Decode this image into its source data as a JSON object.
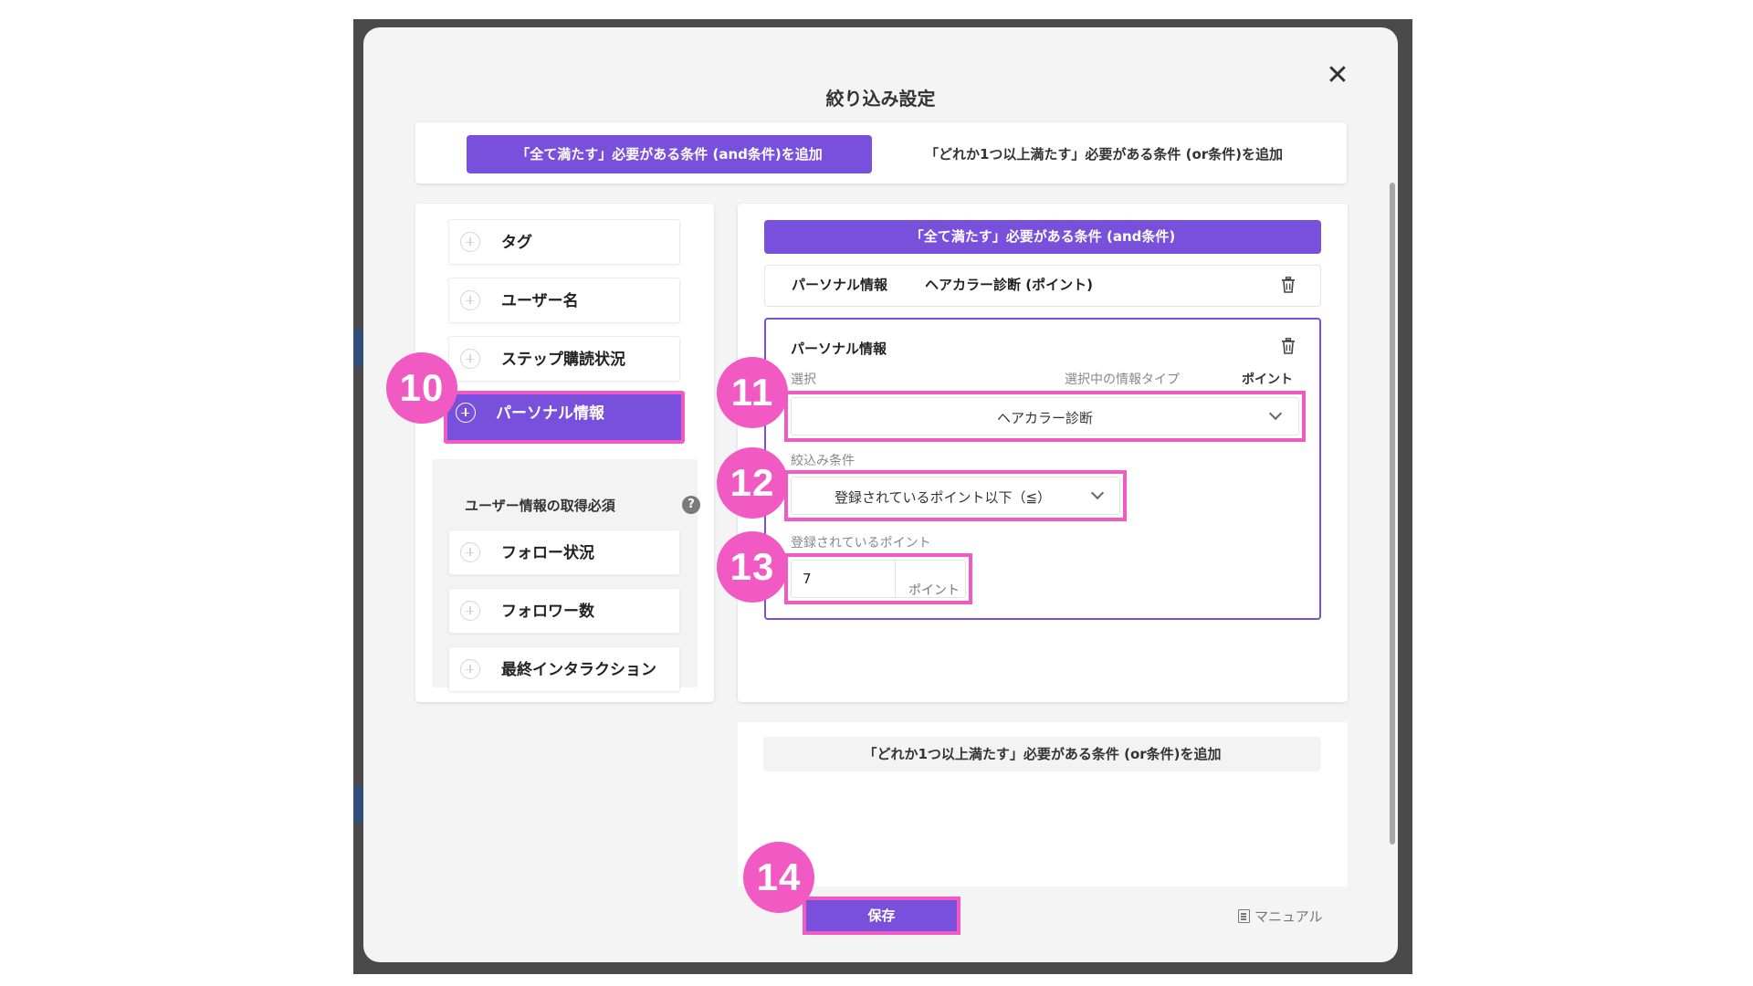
{
  "modal": {
    "title": "絞り込み設定",
    "close_label": "✕"
  },
  "mode_tabs": {
    "and_label": "「全て満たす」必要がある条件 (and条件)を追加",
    "or_label": "「どれか1つ以上満たす」必要がある条件 (or条件)を追加"
  },
  "condition_items": [
    {
      "label": "タグ"
    },
    {
      "label": "ユーザー名"
    },
    {
      "label": "ステップ購読状況"
    },
    {
      "label": "パーソナル情報"
    }
  ],
  "user_info": {
    "header": "ユーザー情報の取得必須",
    "help_label": "?",
    "items": [
      {
        "label": "フォロー状況"
      },
      {
        "label": "フォロワー数"
      },
      {
        "label": "最終インタラクション"
      }
    ]
  },
  "and_section": {
    "header": "「全て満たす」必要がある条件 (and条件)",
    "selected_row": {
      "category": "パーソナル情報",
      "value": "ヘアカラー診断 (ポイント)"
    },
    "edit_card": {
      "title": "パーソナル情報",
      "select_label": "選択",
      "info_type_label": "選択中の情報タイプ",
      "info_type_value": "ポイント",
      "select_value": "ヘアカラー診断",
      "filter_label": "絞込み条件",
      "filter_value": "登録されているポイント以下（≦）",
      "points_label": "登録されているポイント",
      "points_value": "7",
      "points_unit": "ポイント"
    }
  },
  "or_section": {
    "button_label": "「どれか1つ以上満たす」必要がある条件 (or条件)を追加"
  },
  "footer": {
    "save_label": "保存",
    "manual_label": "マニュアル"
  },
  "badges": [
    "10",
    "11",
    "12",
    "13",
    "14"
  ],
  "colors": {
    "accent": "#7850dc",
    "highlight": "#f05ac2",
    "backdrop": "#4a4a4a"
  }
}
